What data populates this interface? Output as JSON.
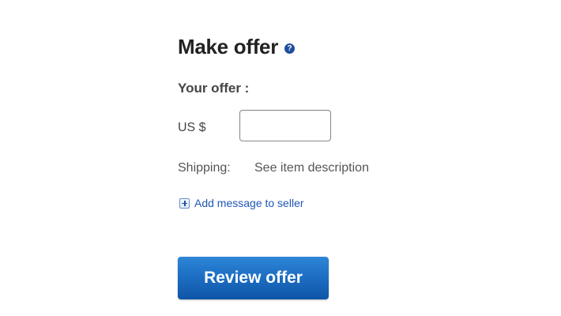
{
  "form": {
    "title": "Make offer",
    "help_icon_label": "?",
    "your_offer_label": "Your offer :",
    "currency_label": "US $",
    "offer_value": "",
    "shipping_label": "Shipping:",
    "shipping_value": "See item description",
    "add_message_label": "Add message to seller",
    "submit_label": "Review offer"
  },
  "colors": {
    "accent": "#1f56b8",
    "button": "#1d6fc4"
  },
  "icons": {
    "help": "help-icon",
    "add": "plus-icon"
  }
}
